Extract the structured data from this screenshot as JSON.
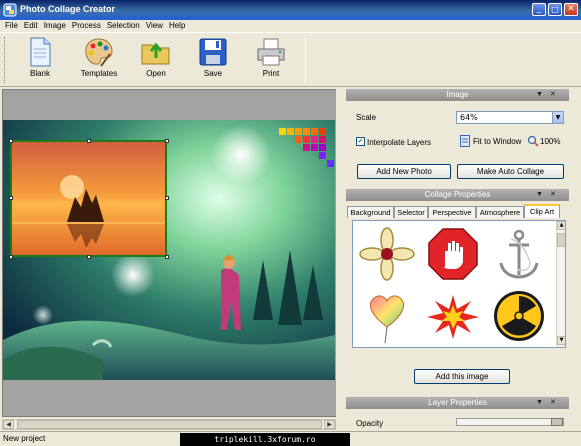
{
  "window": {
    "title": "Photo Collage Creator",
    "controls": {
      "minimize": "_",
      "maximize": "□",
      "close": "✕"
    }
  },
  "menu": [
    "File",
    "Edit",
    "Image",
    "Process",
    "Selection",
    "View",
    "Help"
  ],
  "toolbar": {
    "buttons": [
      {
        "label": "Blank",
        "icon": "blank-page-icon"
      },
      {
        "label": "Templates",
        "icon": "palette-icon"
      },
      {
        "label": "Open",
        "icon": "open-folder-icon"
      },
      {
        "label": "Save",
        "icon": "floppy-disk-icon"
      },
      {
        "label": "Print",
        "icon": "printer-icon"
      }
    ]
  },
  "image_panel": {
    "title": "Image",
    "scale_label": "Scale",
    "scale_value": "64%",
    "interpolate_label": "Interpolate Layers",
    "interpolate_checked": true,
    "fit_to_window": "Fit to Window",
    "zoom_100": "100%",
    "add_new_photo": "Add New Photo",
    "make_auto_collage": "Make Auto Collage"
  },
  "collage_panel": {
    "title": "Collage Properties",
    "tabs": [
      "Background",
      "Selector",
      "Perspective",
      "Atmosphere",
      "Clip Art"
    ],
    "active_tab": "Clip Art",
    "clipart_items": [
      "flower-ornament",
      "stop-hand-sign",
      "anchor",
      "heart-balloon",
      "explosion-burst",
      "radiation-symbol"
    ],
    "add_image_button": "Add this image"
  },
  "layer_panel": {
    "title": "Layer Properties",
    "opacity_label": "Opacity"
  },
  "status": {
    "text": "New project",
    "watermark": "triplekill.3xforum.ro"
  },
  "colors": {
    "title_bar": "#0a246a",
    "panel_header": "#9a9a9a",
    "frame_border": "#1d7a1d",
    "canvas_bg": "#a3a3a3"
  }
}
